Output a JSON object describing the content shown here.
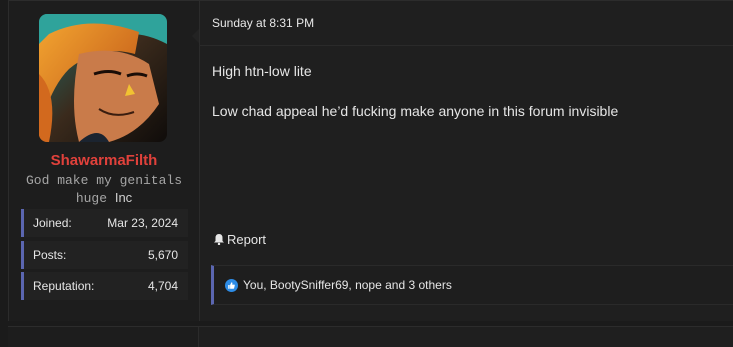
{
  "author": {
    "username": "ShawarmaFilth",
    "title": "God make my genitals huge",
    "title_suffix": "Inc",
    "avatar": "anime-style-character-portrait",
    "username_color": "#e0413b",
    "stats": [
      {
        "label": "Joined:",
        "value": "Mar 23, 2024"
      },
      {
        "label": "Posts:",
        "value": "5,670"
      },
      {
        "label": "Reputation:",
        "value": "4,704"
      }
    ]
  },
  "post": {
    "timestamp": "Sunday at 8:31 PM",
    "lines": [
      "High htn-low lite",
      "Low chad appeal he’d fucking make anyone in this forum invisible"
    ],
    "report_label": "Report",
    "report_icon": "bell-icon",
    "reactions_icon": "like-icon",
    "reactions_text": "You, BootySniffer69, nope and 3 others"
  },
  "colors": {
    "accent": "#5b66b0",
    "background": "#1b1b1b",
    "like_blue": "#2d8ce6"
  }
}
